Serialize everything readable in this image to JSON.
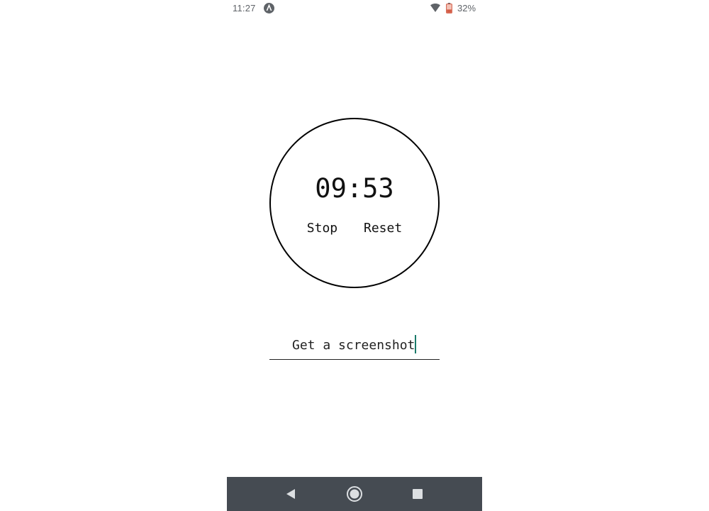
{
  "status_bar": {
    "time": "11:27",
    "app_icon": "a-circle-icon",
    "wifi_icon": "wifi-icon",
    "battery_icon": "battery-low-icon",
    "battery_percent": "32%",
    "battery_color": "#d35b45"
  },
  "timer": {
    "display": "09:53",
    "stop_label": "Stop",
    "reset_label": "Reset"
  },
  "task_field": {
    "value": "Get a screenshot",
    "caret_color": "#1a7a6a"
  },
  "nav_bar": {
    "back_icon": "triangle-back-icon",
    "home_icon": "circle-home-icon",
    "recents_icon": "square-recents-icon",
    "background": "#454b52"
  }
}
